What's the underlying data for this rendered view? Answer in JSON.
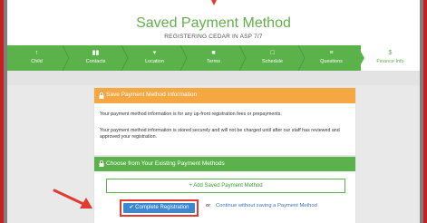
{
  "header": {
    "title": "Saved Payment Method",
    "subtitle": "REGISTERING CEDAR IN ASP 7/7"
  },
  "steps": [
    {
      "label": "Child",
      "icon": "child-icon",
      "glyph": "↑"
    },
    {
      "label": "Contacts",
      "icon": "contacts-icon",
      "glyph": "▮▮"
    },
    {
      "label": "Location",
      "icon": "location-pin-icon",
      "glyph": "▾"
    },
    {
      "label": "Terms",
      "icon": "document-icon",
      "glyph": "■"
    },
    {
      "label": "Schedule",
      "icon": "calendar-icon",
      "glyph": "□"
    },
    {
      "label": "Questions",
      "icon": "list-icon",
      "glyph": "≡"
    },
    {
      "label": "Finance Info",
      "icon": "dollar-icon",
      "glyph": "$"
    }
  ],
  "save_panel": {
    "heading": "Save Payment Method Information",
    "line1": "Your payment method information is for any up-front registration fees or prepayments.",
    "line2": "Your payment method information is stored securely and will not be charged until after our staff has reviewed and approved your registration."
  },
  "choose_panel": {
    "heading": "Choose from Your Existing Payment Methods",
    "add_button": "+ Add Saved Payment Method",
    "complete_button": "Complete Registration",
    "or_text": "or",
    "continue_link": "Continue without saving a Payment Method"
  },
  "colors": {
    "green": "#5bb24a",
    "orange": "#f5a842",
    "blue": "#3b87d1",
    "red": "#e23a2f"
  }
}
